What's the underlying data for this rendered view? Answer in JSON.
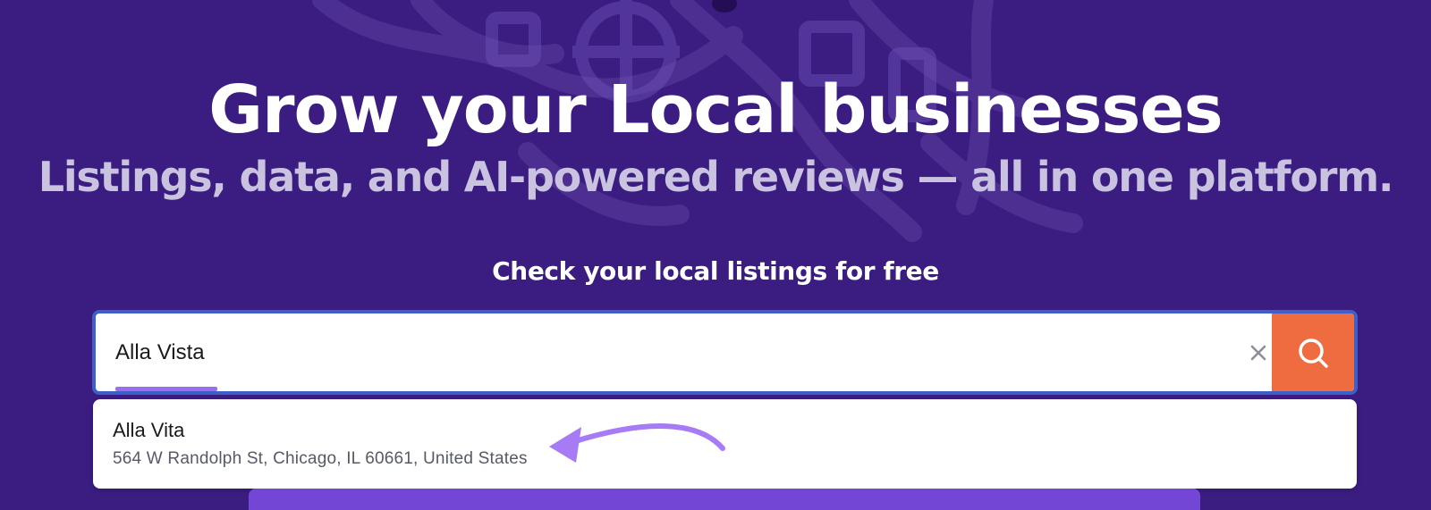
{
  "hero": {
    "headline": "Grow your Local businesses",
    "subheadline": "Listings, data, and AI-powered reviews — all in one platform.",
    "check_label": "Check your local listings for free"
  },
  "search": {
    "value": "Alla Vista",
    "clear_icon": "close-icon",
    "submit_icon": "search-icon"
  },
  "dropdown": {
    "suggestions": [
      {
        "name": "Alla Vita",
        "address": "564 W Randolph St, Chicago, IL 60661, United States"
      }
    ]
  },
  "colors": {
    "background": "#3b1c80",
    "accent_orange": "#ee6c3f",
    "input_border": "#3f5fc8",
    "annotation_arrow": "#a77bf3",
    "bottom_bar": "#7446d6"
  }
}
